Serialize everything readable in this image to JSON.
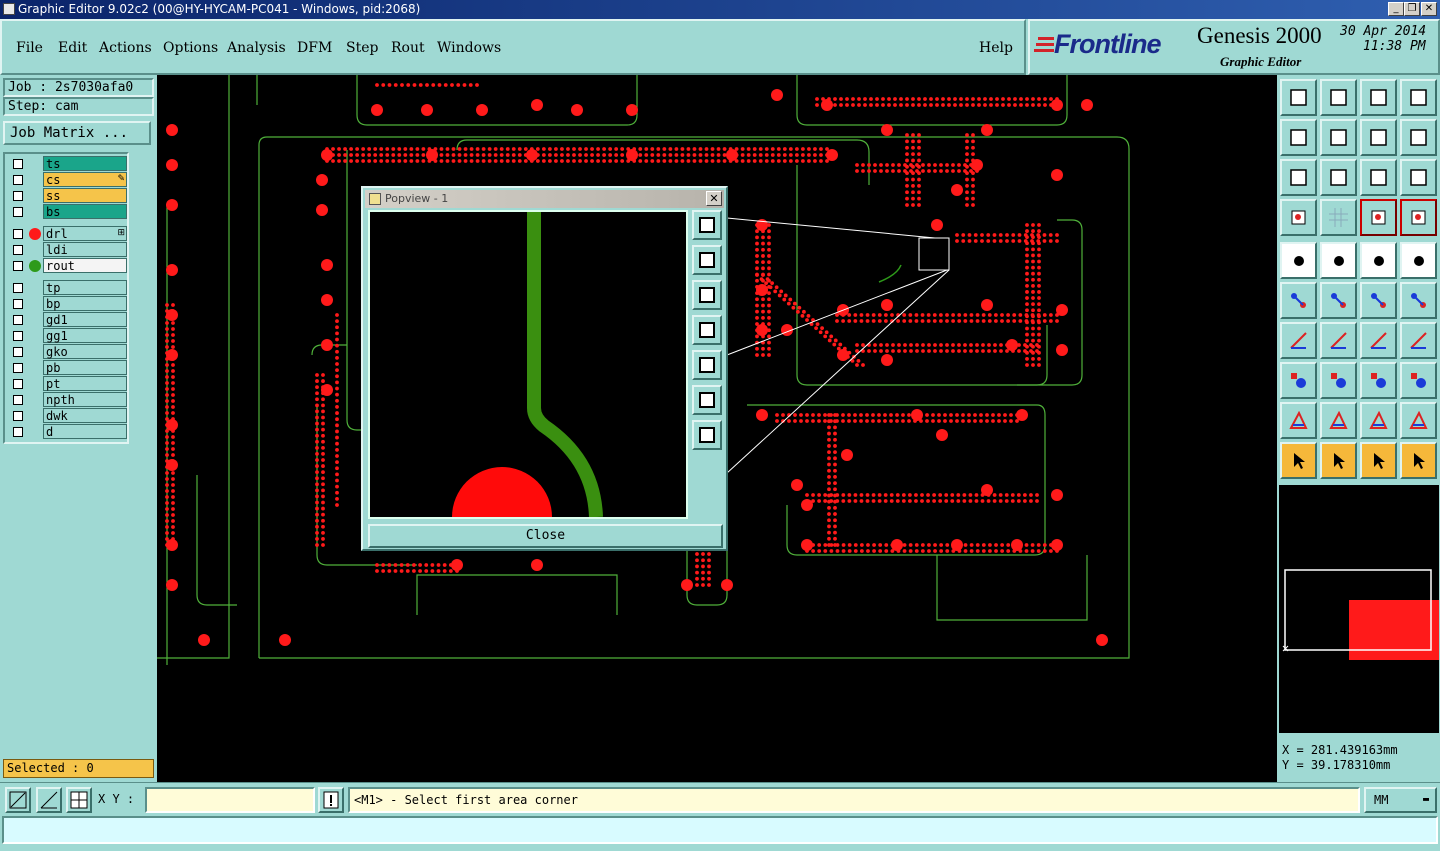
{
  "window": {
    "title": "Graphic Editor 9.02c2 (00@HY-HYCAM-PC041 - Windows, pid:2068)",
    "minimize": "_",
    "maximize": "❐",
    "close": "✕"
  },
  "menu": {
    "items": [
      "File",
      "Edit",
      "Actions",
      "Options",
      "Analysis",
      "DFM",
      "Step",
      "Rout",
      "Windows"
    ],
    "help": "Help"
  },
  "brand": {
    "logo": "Frontline",
    "product": "Genesis 2000",
    "subtitle": "Graphic Editor",
    "date": "30 Apr 2014",
    "time": "11:38 PM"
  },
  "job": {
    "job_label": "Job : 2s7030afa0",
    "step_label": "Step: cam",
    "matrix_button": "Job Matrix ..."
  },
  "layers": [
    {
      "name": "ts",
      "color": "#1aa58a",
      "symbol": ""
    },
    {
      "name": "cs",
      "color": "#f5c44a",
      "symbol": "",
      "flag": "✎"
    },
    {
      "name": "ss",
      "color": "#f5c44a",
      "symbol": ""
    },
    {
      "name": "bs",
      "color": "#1aa58a",
      "symbol": ""
    },
    {
      "name": "drl",
      "color": "#9fd9d3",
      "symbol": "#ff1a1a",
      "flag": "⊞"
    },
    {
      "name": "ldi",
      "color": "#9fd9d3",
      "symbol": ""
    },
    {
      "name": "rout",
      "color": "#f4f4f4",
      "symbol": "#2e9a1a"
    },
    {
      "name": "tp",
      "color": "#9fd9d3",
      "symbol": ""
    },
    {
      "name": "bp",
      "color": "#9fd9d3",
      "symbol": ""
    },
    {
      "name": "gd1",
      "color": "#9fd9d3",
      "symbol": ""
    },
    {
      "name": "gg1",
      "color": "#9fd9d3",
      "symbol": ""
    },
    {
      "name": "gko",
      "color": "#9fd9d3",
      "symbol": ""
    },
    {
      "name": "pb",
      "color": "#9fd9d3",
      "symbol": ""
    },
    {
      "name": "pt",
      "color": "#9fd9d3",
      "symbol": ""
    },
    {
      "name": "npth",
      "color": "#9fd9d3",
      "symbol": ""
    },
    {
      "name": "dwk",
      "color": "#9fd9d3",
      "symbol": ""
    },
    {
      "name": "d",
      "color": "#9fd9d3",
      "symbol": ""
    }
  ],
  "selected": "Selected : 0",
  "popview": {
    "title": "Popview - 1",
    "close_label": "Close",
    "close_x": "✕"
  },
  "coords": {
    "x": "X = 281.439163mm",
    "y": "Y =  39.178310mm"
  },
  "status": {
    "xy_label": "X Y :",
    "xy_value": "",
    "prompt": "<M1> - Select first area corner",
    "units": "MM",
    "message": ""
  },
  "colors": {
    "panel": "#9fd9d3",
    "pad": "#ff1a1a",
    "trace": "#2e9a1a",
    "outline": "#4fb03a"
  }
}
